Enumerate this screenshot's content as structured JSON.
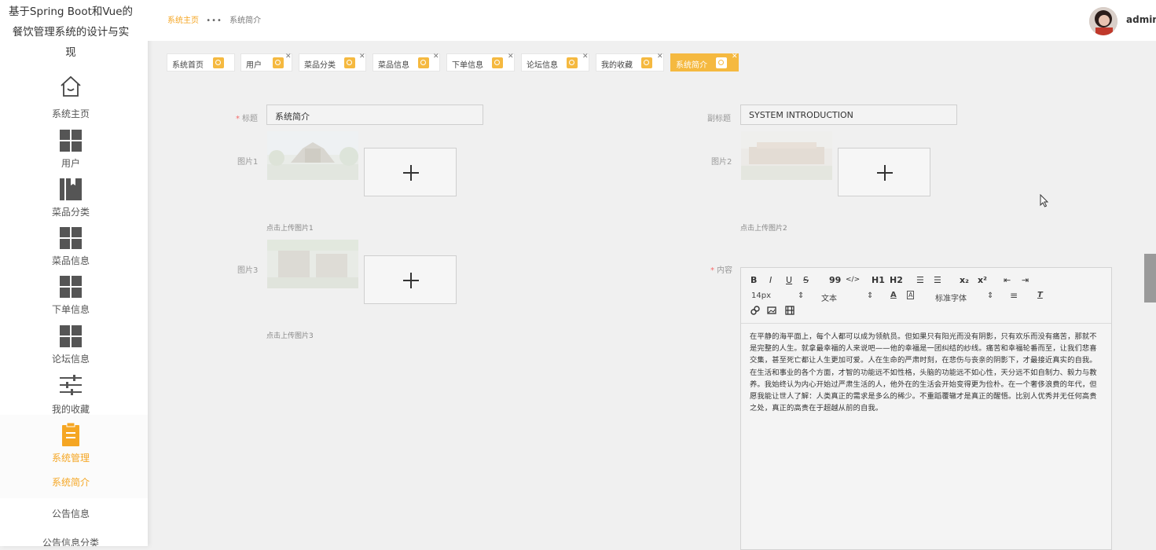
{
  "app": {
    "title_line1": "基于Spring Boot和Vue的",
    "title_line2": "餐饮管理系统的设计与实",
    "title_line3": "现"
  },
  "sidebar": {
    "items": [
      {
        "label": "系统主页",
        "icon": "home-icon"
      },
      {
        "label": "用户",
        "icon": "grid-icon"
      },
      {
        "label": "菜品分类",
        "icon": "book-icon"
      },
      {
        "label": "菜品信息",
        "icon": "grid-icon"
      },
      {
        "label": "下单信息",
        "icon": "grid-icon"
      },
      {
        "label": "论坛信息",
        "icon": "grid-icon"
      },
      {
        "label": "我的收藏",
        "icon": "sliders-icon"
      },
      {
        "label": "系统管理",
        "icon": "clipboard-icon"
      }
    ],
    "sub_items": [
      {
        "label": "系统简介"
      },
      {
        "label": "公告信息"
      },
      {
        "label": "公告信息分类"
      }
    ],
    "active_color": "#f5a623"
  },
  "header": {
    "breadcrumb_home": "系统主页",
    "breadcrumb_sep": "•••",
    "breadcrumb_current": "系统简介",
    "username": "admin"
  },
  "tabs": [
    {
      "label": "系统首页",
      "closable": false
    },
    {
      "label": "用户",
      "closable": true
    },
    {
      "label": "菜品分类",
      "closable": true
    },
    {
      "label": "菜品信息",
      "closable": true
    },
    {
      "label": "下单信息",
      "closable": true
    },
    {
      "label": "论坛信息",
      "closable": true
    },
    {
      "label": "我的收藏",
      "closable": true
    },
    {
      "label": "系统简介",
      "closable": true,
      "active": true
    }
  ],
  "form": {
    "title_label": "标题",
    "title_required": "*",
    "title_value": "系统简介",
    "subtitle_label": "副标题",
    "subtitle_value": "SYSTEM INTRODUCTION",
    "image1_label": "图片1",
    "image1_hint": "点击上传图片1",
    "image2_label": "图片2",
    "image2_hint": "点击上传图片2",
    "image3_label": "图片3",
    "image3_hint": "点击上传图片3",
    "content_label": "内容",
    "content_required": "*"
  },
  "editor": {
    "toolbar_row1": [
      "B",
      "I",
      "U",
      "S",
      "99",
      "</>",
      "H1",
      "H2",
      "☰",
      "☰",
      "x₂",
      "x²",
      "⇤",
      "⇥"
    ],
    "font_size": "14px",
    "text_style": "文本",
    "font_family": "标准字体",
    "content": "在平静的海平面上，每个人都可以成为领航员。但如果只有阳光而没有阴影，只有欢乐而没有痛苦，那就不是完整的人生。就拿最幸福的人来说吧——他的幸福是一团纠结的纱线。痛苦和幸福轮番而至，让我们悲喜交集，甚至死亡都让人生更加可爱。人在生命的严肃时刻，在悲伤与丧亲的阴影下，才最接近真实的自我。在生活和事业的各个方面，才智的功能远不如性格，头脑的功能远不如心性，天分远不如自制力、毅力与教养。我始终认为内心开始过严肃生活的人，他外在的生活会开始变得更为俭朴。在一个奢侈浪费的年代，但愿我能让世人了解：人类真正的需求是多么的稀少。不重蹈覆辙才是真正的醒悟。比别人优秀并无任何高贵之处，真正的高贵在于超越从前的自我。"
  },
  "colors": {
    "accent": "#f5a623",
    "tab_active": "#f5b940",
    "page_bg": "#f0f0f0"
  }
}
